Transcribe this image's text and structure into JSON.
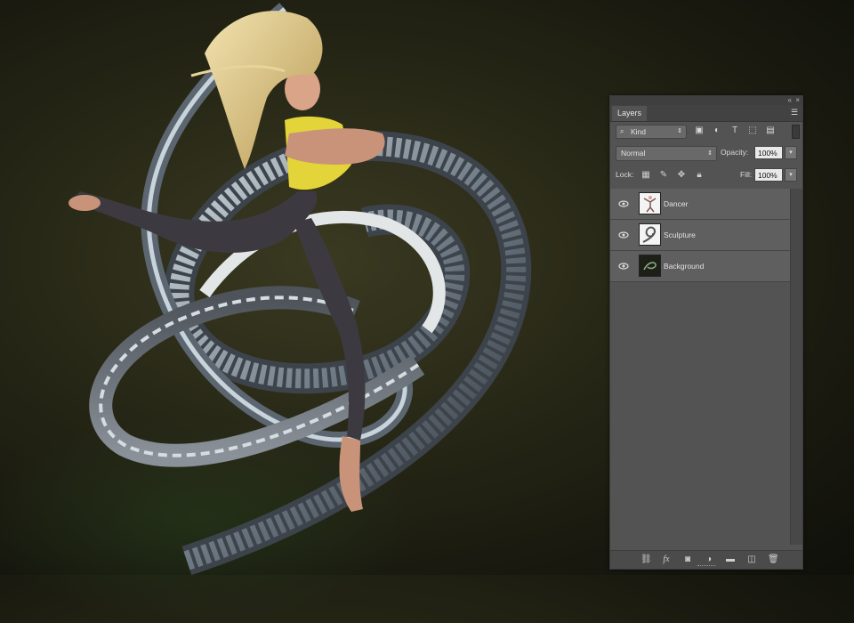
{
  "panel": {
    "tab_label": "Layers",
    "collapse_glyph": "«",
    "close_glyph": "×",
    "menu_icon": "panel-menu-icon",
    "filter": {
      "kind_label": "Kind",
      "icons": [
        "image-filter-icon",
        "adjustment-filter-icon",
        "type-filter-icon",
        "shape-filter-icon",
        "smart-object-filter-icon"
      ]
    },
    "blend_mode": "Normal",
    "opacity_label": "Opacity:",
    "opacity_value": "100%",
    "lock_label": "Lock:",
    "lock_icons": [
      "lock-transparent-icon",
      "lock-image-icon",
      "lock-position-icon",
      "lock-all-icon"
    ],
    "fill_label": "Fill:",
    "fill_value": "100%",
    "layers": [
      {
        "name": "Dancer",
        "visible": true,
        "thumb": "dancer-thumbnail"
      },
      {
        "name": "Sculpture",
        "visible": true,
        "thumb": "sculpture-thumbnail"
      },
      {
        "name": "Background",
        "visible": true,
        "thumb": "background-thumbnail"
      }
    ],
    "bottom_icons": [
      "link-layers-icon",
      "fx-icon",
      "add-mask-icon",
      "adjustment-layer-icon",
      "new-group-icon",
      "new-layer-icon",
      "delete-layer-icon"
    ]
  },
  "colors": {
    "panel_bg": "#535353",
    "canvas_bg": "#2a2a18",
    "top_highlight": "#f0d64a"
  }
}
